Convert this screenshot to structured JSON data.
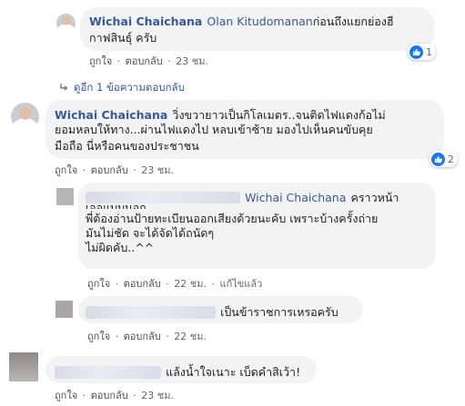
{
  "actions": {
    "like": "ถูกใจ",
    "reply": "ตอบกลับ",
    "edit": "แก้ไขแล้ว",
    "sep": "·"
  },
  "comment1": {
    "author": "Wichai Chaichana",
    "tag": "Olan Kitudomanan",
    "text_line1": "ก่อนถึงแยกย่องฮี",
    "text_line2": "กาฟสินธุ์ ครับ",
    "time": "23 ชม.",
    "reactions": "1"
  },
  "replies_link": "ดูอีก 1 ข้อความตอบกลับ",
  "comment2": {
    "author": "Wichai Chaichana",
    "text_line1": "วิ่งขวายาวเป็นกิโลเมตร..จนติดไฟแดงก้อไม่",
    "text_line2": "ยอมหลบให้ทาง...ผ่านไฟแดงไป หลบเข้าซ้าย มองไปเห็นคนขับคุย",
    "text_line3": "มือถือ นี่หรือคนของประชาชน",
    "time": "23 ชม.",
    "reactions": "2"
  },
  "reply1": {
    "tag": "Wichai Chaichana",
    "text_line1": "คราวหน้า",
    "text_line2": "เจอแบบนอก",
    "text_line3": "พี่ต้องอ่านป้ายทะเบียนออกเสียงด้วยนะคับ เพราะบ้างครั้งถ่าย",
    "text_line4": "มันไม่ชัด จะได้จัดได้ถนัดๆ",
    "text_line5": "ไม่ผิดคับ..^^",
    "time": "22 ชม."
  },
  "reply2": {
    "text": "เป็นข้าราชการเหรอครับ",
    "time": "22 ชม."
  },
  "comment3": {
    "text": "แล้งน้ำใจเนาะ เบ็ดคำสิเว้า!",
    "time": "23 ชม."
  },
  "colors": {
    "link": "#385898",
    "bubble": "#f2f3f5",
    "like": "#1877f2"
  }
}
